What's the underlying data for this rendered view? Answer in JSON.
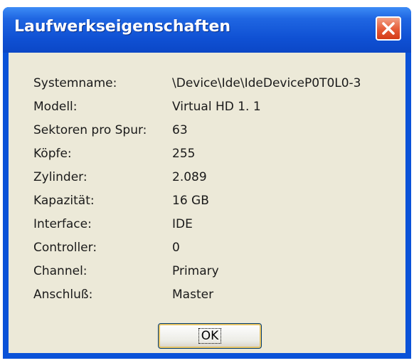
{
  "window": {
    "title": "Laufwerkseigenschaften"
  },
  "properties": [
    {
      "label": "Systemname:",
      "value": "\\Device\\Ide\\IdeDeviceP0T0L0-3"
    },
    {
      "label": "Modell:",
      "value": "Virtual HD 1. 1"
    },
    {
      "label": "Sektoren pro Spur:",
      "value": "63"
    },
    {
      "label": "Köpfe:",
      "value": "255"
    },
    {
      "label": "Zylinder:",
      "value": "2.089"
    },
    {
      "label": "Kapazität:",
      "value": "16 GB"
    },
    {
      "label": "Interface:",
      "value": "IDE"
    },
    {
      "label": "Controller:",
      "value": "0"
    },
    {
      "label": "Channel:",
      "value": "Primary"
    },
    {
      "label": "Anschluß:",
      "value": "Master"
    }
  ],
  "buttons": {
    "ok_label": "OK"
  },
  "icons": {
    "close": "close-icon"
  },
  "colors": {
    "titlebar": "#0a52d8",
    "client": "#ece9d8",
    "close_button": "#e55a36"
  }
}
